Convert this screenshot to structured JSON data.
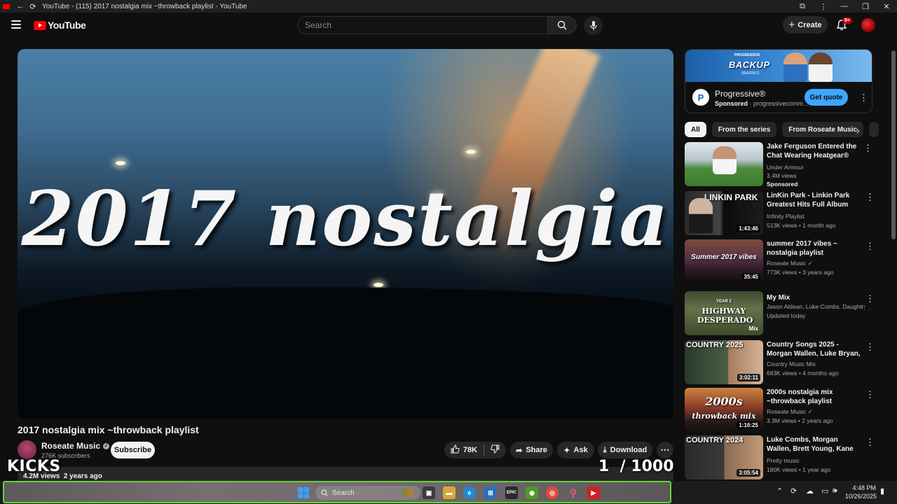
{
  "browser": {
    "tab_title": "YouTube - (115) 2017 nostalgia mix ~throwback playlist - YouTube"
  },
  "header": {
    "logo_text": "YouTube",
    "search_placeholder": "Search",
    "create_label": "Create",
    "notification_count": "9+"
  },
  "video": {
    "overlay_title": "2017 nostalgia",
    "title": "2017 nostalgia mix ~throwback playlist",
    "channel": "Roseate Music",
    "subscribers": "276K subscribers",
    "subscribe_label": "Subscribe",
    "likes": "78K",
    "share_label": "Share",
    "ask_label": "Ask",
    "download_label": "Download",
    "views": "4.2M views",
    "uploaded": "2 years ago"
  },
  "overlay": {
    "kicks": "KICKS",
    "counter_current": "1",
    "counter_total": "/ 1000"
  },
  "ad": {
    "banner_text": "BACKUP",
    "banner_small": "PROGRESSIVE",
    "banner_season": "SEASON 2",
    "advertiser": "Progressive®",
    "sponsored": "Sponsored",
    "domain": "progressivecomm...",
    "cta": "Get quote"
  },
  "chips": [
    "All",
    "From the series",
    "From Roseate Music"
  ],
  "recommendations": [
    {
      "title": "Jake Ferguson Entered the Chat Wearing Heatgear®",
      "channel": "Under Armour",
      "meta": "3.4M views",
      "extra": "Sponsored",
      "duration": ""
    },
    {
      "title": "LinKin Park - Linkin Park Greatest Hits Full Album 2025 ...",
      "channel": "Infinity Playlist",
      "meta": "513K views • 1 month ago",
      "extra": "",
      "duration": "1:43:46",
      "thumb_text": "LINKIN PARK"
    },
    {
      "title": "summer 2017 vibes ~ nostalgia playlist",
      "channel": "Roseate Music",
      "meta": "773K views • 3 years ago",
      "extra": "",
      "duration": "35:45",
      "thumb_text": "Summer 2017 vibes"
    },
    {
      "title": "My Mix",
      "channel": "Jason Aldean, Luke Combs, Daughtry, an...",
      "meta": "Updated today",
      "extra": "",
      "duration": "Mix",
      "thumb_text": "HIGHWAY DESPERADO",
      "thumb_small": "YEAR 2"
    },
    {
      "title": "Country Songs 2025 - Morgan Wallen, Luke Bryan, Luke ...",
      "channel": "Country Music Mix",
      "meta": "683K views • 4 months ago",
      "extra": "",
      "duration": "3:02:11",
      "thumb_text": "COUNTRY 2025"
    },
    {
      "title": "2000s nostalgia mix ~throwback playlist",
      "channel": "Roseate Music",
      "meta": "3.3M views • 2 years ago",
      "extra": "",
      "duration": "1:16:25",
      "thumb_text": "2000s",
      "thumb_text2": "throwback mix"
    },
    {
      "title": "Luke Combs, Morgan Wallen, Brett Young, Kane Brown, Jas...",
      "channel": "Pretty music",
      "meta": "180K views • 1 year ago",
      "extra": "",
      "duration": "3:05:54",
      "thumb_text": "COUNTRY 2024"
    }
  ],
  "taskbar": {
    "search_label": "Search",
    "time": "4:48 PM",
    "date": "10/26/2025"
  },
  "colors": {
    "background": "#0f0f0f",
    "youtube_red": "#ff0000",
    "cta_blue": "#3ea6ff",
    "taskbar_highlight": "#63d43a"
  }
}
